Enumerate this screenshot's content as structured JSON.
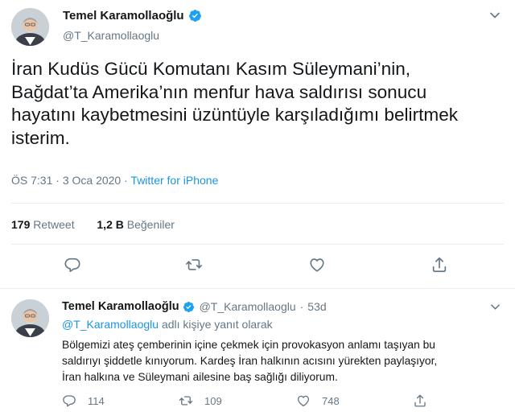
{
  "main_tweet": {
    "author_name": "Temel Karamollaoğlu",
    "author_handle": "@T_Karamollaoglu",
    "text_lines": [
      "İran Kudüs Gücü Komutanı Kasım Süleymani’nin,",
      "Bağdat’ta Amerika’nın menfur hava saldırısı sonucu",
      "hayatını kaybetmesini üzüntüyle karşıladığımı belirtmek",
      "isterim."
    ],
    "time": "ÖS 7:31",
    "date": "3 Oca 2020",
    "separator": "·",
    "source": "Twitter for iPhone",
    "retweet_count": "179",
    "retweet_label": "Retweet",
    "like_count": "1,2 B",
    "like_label": "Beğeniler"
  },
  "reply_tweet": {
    "author_name": "Temel Karamollaoğlu",
    "author_handle": "@T_Karamollaoglu",
    "separator": "·",
    "age": "53d",
    "replying_mention": "@T_Karamollaoglu",
    "replying_suffix": "adlı kişiye yanıt olarak",
    "text_lines": [
      "Bölgemizi ateş çemberinin içine çekmek için provokasyon anlamı taşıyan bu",
      "saldırıyı şiddetle kınıyorum. Kardeş İran halkının acısını yürekten paylaşıyor,",
      "İran halkına ve Süleymani ailesine baş sağlığı diliyorum."
    ],
    "reply_count": "114",
    "retweet_count": "109",
    "like_count": "748"
  },
  "colors": {
    "accent": "#1b95e0",
    "secondary_text": "#657786",
    "primary_text": "#14171a",
    "divider": "#e6ecf0",
    "verified": "#1da1f2"
  },
  "icons": [
    "verified-badge-icon",
    "chevron-down-icon",
    "reply-icon",
    "retweet-icon",
    "like-icon",
    "share-icon"
  ]
}
